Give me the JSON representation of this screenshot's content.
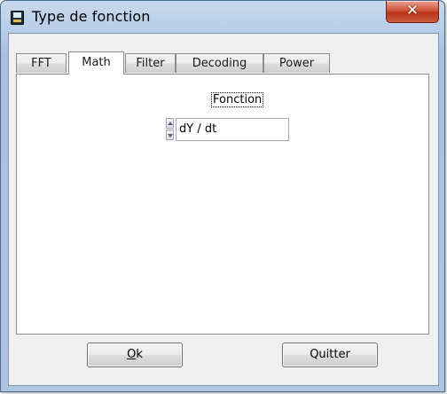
{
  "window": {
    "title": "Type de fonction",
    "close_glyph": "✕"
  },
  "tabs": [
    {
      "label": "FFT",
      "active": false
    },
    {
      "label": "Math",
      "active": true
    },
    {
      "label": "Filter",
      "active": false
    },
    {
      "label": "Decoding",
      "active": false
    },
    {
      "label": "Power",
      "active": false
    }
  ],
  "panel": {
    "fonction_label": "Fonction",
    "function_value": "dY / dt"
  },
  "buttons": {
    "ok_mnemonic": "O",
    "ok_rest": "k",
    "quit_label": "Quitter"
  },
  "icons": {
    "app": "oscilloscope-app-icon",
    "close": "close-icon",
    "spin_up": "arrow-up-icon",
    "spin_down": "arrow-down-icon"
  },
  "colors": {
    "titlebar": "#b5cbe5",
    "close_button": "#c7432a",
    "client": "#f0f0f0"
  }
}
